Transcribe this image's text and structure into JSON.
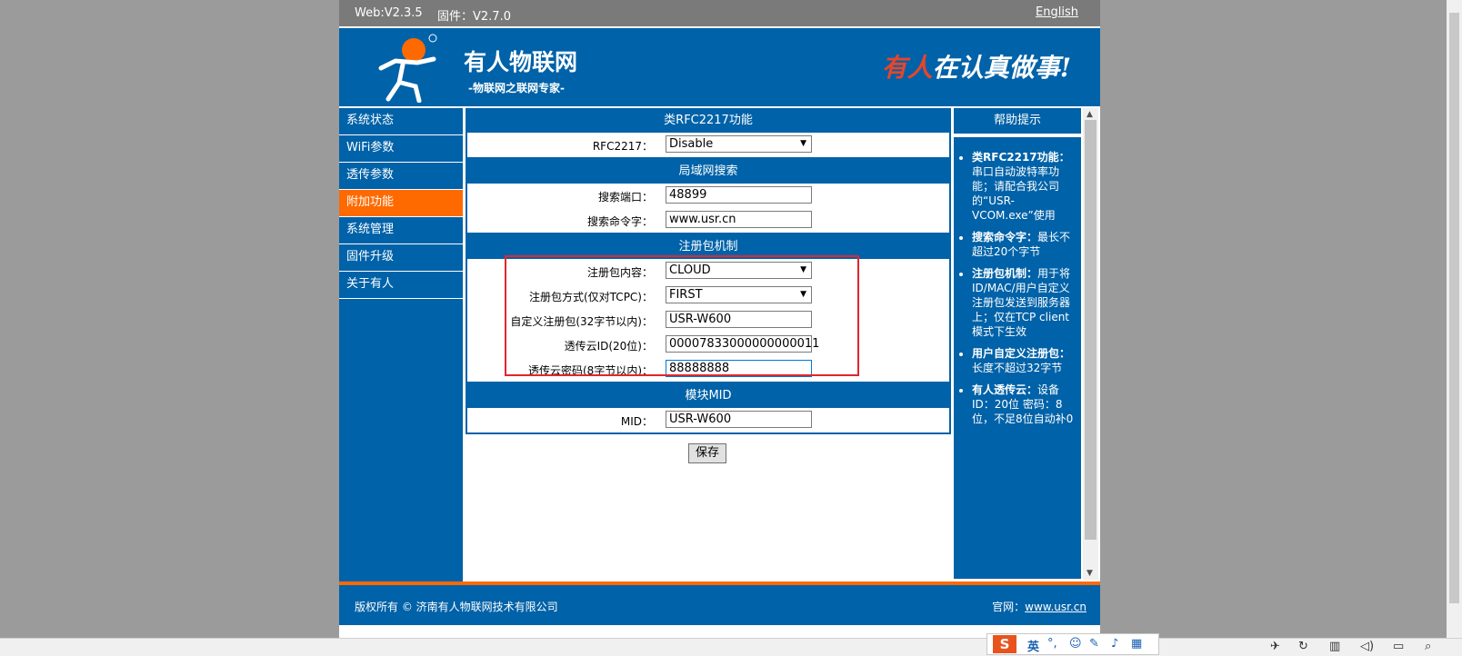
{
  "topbar": {
    "web_version": "Web:V2.3.5",
    "firmware": "固件：V2.7.0",
    "language_link": "English"
  },
  "header": {
    "brand": "有人物联网",
    "brand_sub": "-物联网之联网专家-",
    "slogan_red": "有人",
    "slogan_rest": "在认真做事!"
  },
  "sidebar": {
    "items": [
      {
        "label": "系统状态"
      },
      {
        "label": "WiFi参数"
      },
      {
        "label": "透传参数"
      },
      {
        "label": "附加功能"
      },
      {
        "label": "系统管理"
      },
      {
        "label": "固件升级"
      },
      {
        "label": "关于有人"
      }
    ]
  },
  "rfc": {
    "title": "类RFC2217功能",
    "label": "RFC2217：",
    "value": "Disable"
  },
  "lan": {
    "title": "局域网搜索",
    "port_label": "搜索端口：",
    "port_value": "48899",
    "keyword_label": "搜索命令字：",
    "keyword_value": "www.usr.cn"
  },
  "reg": {
    "title": "注册包机制",
    "content_label": "注册包内容：",
    "content_value": "CLOUD",
    "mode_label": "注册包方式(仅对TCPC)：",
    "mode_value": "FIRST",
    "custom_label": "自定义注册包(32字节以内)：",
    "custom_value": "USR-W600",
    "cloud_id_label": "透传云ID(20位)：",
    "cloud_id_value": "00007833000000000011",
    "cloud_pwd_label": "透传云密码(8字节以内)：",
    "cloud_pwd_value": "88888888"
  },
  "mid": {
    "title": "模块MID",
    "label": "MID：",
    "value": "USR-W600"
  },
  "save_label": "保存",
  "help": {
    "title": "帮助提示",
    "items": [
      {
        "head": "类RFC2217功能：",
        "body": "串口自动波特率功能；请配合我公司的“USR-VCOM.exe”使用"
      },
      {
        "head": "搜索命令字：",
        "body": "最长不超过20个字节"
      },
      {
        "head": "注册包机制：",
        "body": "用于将ID/MAC/用户自定义注册包发送到服务器上；仅在TCP client模式下生效"
      },
      {
        "head": "用户自定义注册包：",
        "body": "长度不超过32字节"
      },
      {
        "head": "有人透传云：",
        "body": "设备ID：20位 密码：8位，不足8位自动补0"
      }
    ]
  },
  "footer": {
    "copyright": "版权所有 © 济南有人物联网技术有限公司",
    "site_label": "官网：",
    "site_link": "www.usr.cn"
  },
  "ime": {
    "lang": "英"
  }
}
